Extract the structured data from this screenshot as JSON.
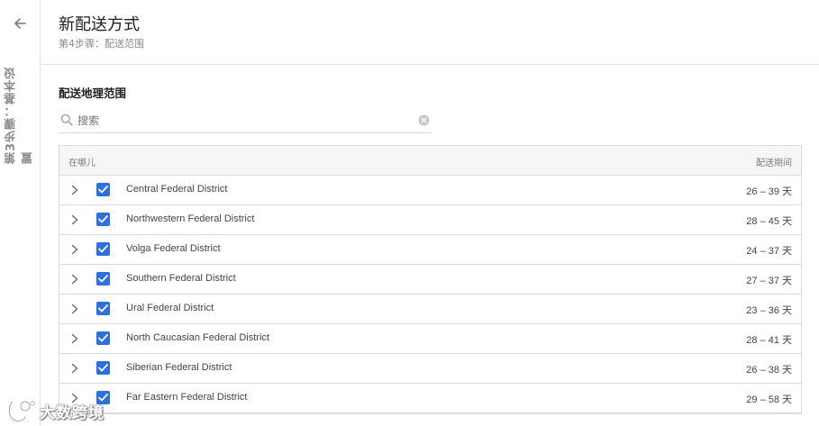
{
  "nav": {
    "back_icon": "arrow-left-icon",
    "previous_step_label": "第3步骤：基本设置"
  },
  "header": {
    "title": "新配送方式",
    "subtitle": "第4步骤：配送范围"
  },
  "section": {
    "title": "配送地理范围"
  },
  "search": {
    "placeholder": "搜索",
    "value": ""
  },
  "table": {
    "columns": {
      "where": "在哪儿",
      "period": "配送期间"
    },
    "unit": "天",
    "rows": [
      {
        "name": "Central Federal District",
        "period": "26 – 39",
        "checked": true
      },
      {
        "name": "Northwestern Federal District",
        "period": "28 – 45",
        "checked": true
      },
      {
        "name": "Volga Federal District",
        "period": "24 – 37",
        "checked": true
      },
      {
        "name": "Southern Federal District",
        "period": "27 – 37",
        "checked": true
      },
      {
        "name": "Ural Federal District",
        "period": "23 – 36",
        "checked": true
      },
      {
        "name": "North Caucasian Federal District",
        "period": "28 – 41",
        "checked": true
      },
      {
        "name": "Siberian Federal District",
        "period": "26 – 38",
        "checked": true
      },
      {
        "name": "Far Eastern Federal District",
        "period": "29 – 58",
        "checked": true
      }
    ]
  },
  "watermark": {
    "text": "大数跨境"
  },
  "colors": {
    "accent": "#2b6fe3",
    "border": "#dcdcdc",
    "header_bg": "#f6f6f7"
  }
}
